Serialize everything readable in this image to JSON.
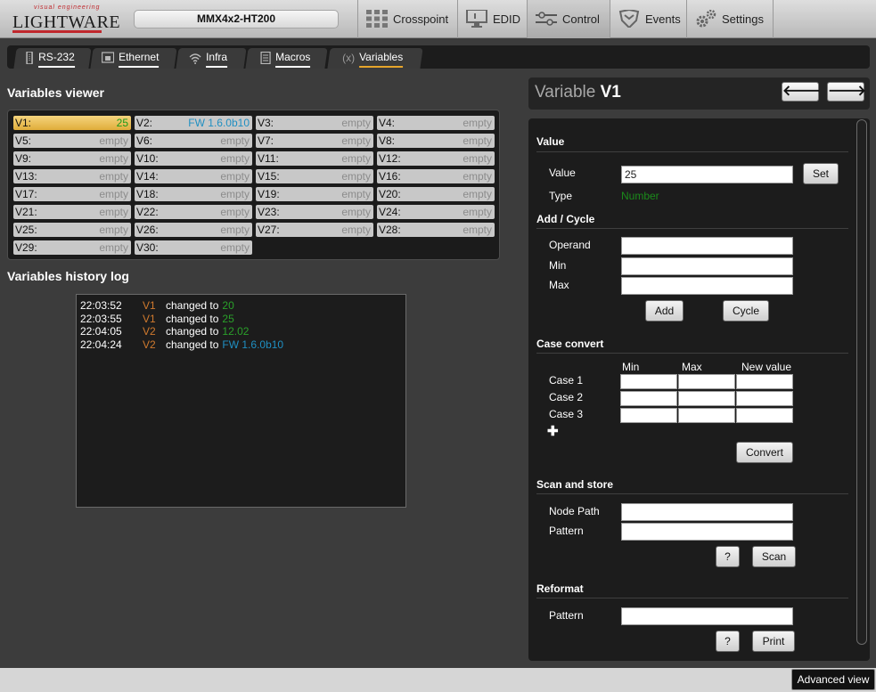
{
  "app": {
    "logo_tagline": "visual engineering",
    "logo_name": "LIGHTWARE",
    "device_name": "MMX4x2-HT200"
  },
  "nav": {
    "tabs": [
      {
        "label": "Crosspoint",
        "icon": "grid-icon"
      },
      {
        "label": "EDID",
        "icon": "monitor-icon"
      },
      {
        "label": "Control",
        "icon": "sliders-icon",
        "active": true
      },
      {
        "label": "Events",
        "icon": "shield-icon"
      },
      {
        "label": "Settings",
        "icon": "gears-icon"
      }
    ]
  },
  "subtabs": [
    {
      "label": "RS-232",
      "icon": "serial-icon"
    },
    {
      "label": "Ethernet",
      "icon": "ethernet-icon"
    },
    {
      "label": "Infra",
      "icon": "wifi-icon"
    },
    {
      "label": "Macros",
      "icon": "document-icon"
    },
    {
      "label": "Variables",
      "icon_text": "(x)",
      "active": true
    }
  ],
  "viewer": {
    "heading": "Variables viewer",
    "variables": [
      {
        "name": "V1:",
        "value": "25"
      },
      {
        "name": "V2:",
        "value": "FW 1.6.0b10"
      },
      {
        "name": "V3:",
        "value": "empty"
      },
      {
        "name": "V4:",
        "value": "empty"
      },
      {
        "name": "V5:",
        "value": "empty"
      },
      {
        "name": "V6:",
        "value": "empty"
      },
      {
        "name": "V7:",
        "value": "empty"
      },
      {
        "name": "V8:",
        "value": "empty"
      },
      {
        "name": "V9:",
        "value": "empty"
      },
      {
        "name": "V10:",
        "value": "empty"
      },
      {
        "name": "V11:",
        "value": "empty"
      },
      {
        "name": "V12:",
        "value": "empty"
      },
      {
        "name": "V13:",
        "value": "empty"
      },
      {
        "name": "V14:",
        "value": "empty"
      },
      {
        "name": "V15:",
        "value": "empty"
      },
      {
        "name": "V16:",
        "value": "empty"
      },
      {
        "name": "V17:",
        "value": "empty"
      },
      {
        "name": "V18:",
        "value": "empty"
      },
      {
        "name": "V19:",
        "value": "empty"
      },
      {
        "name": "V20:",
        "value": "empty"
      },
      {
        "name": "V21:",
        "value": "empty"
      },
      {
        "name": "V22:",
        "value": "empty"
      },
      {
        "name": "V23:",
        "value": "empty"
      },
      {
        "name": "V24:",
        "value": "empty"
      },
      {
        "name": "V25:",
        "value": "empty"
      },
      {
        "name": "V26:",
        "value": "empty"
      },
      {
        "name": "V27:",
        "value": "empty"
      },
      {
        "name": "V28:",
        "value": "empty"
      },
      {
        "name": "V29:",
        "value": "empty"
      },
      {
        "name": "V30:",
        "value": "empty"
      }
    ]
  },
  "history": {
    "heading": "Variables history log",
    "entries": [
      {
        "time": "22:03:52",
        "var": "V1",
        "text": "changed to",
        "value": "20",
        "value_color": "green"
      },
      {
        "time": "22:03:55",
        "var": "V1",
        "text": "changed to",
        "value": "25",
        "value_color": "green"
      },
      {
        "time": "22:04:05",
        "var": "V2",
        "text": "changed to",
        "value": "12.02",
        "value_color": "green"
      },
      {
        "time": "22:04:24",
        "var": "V2",
        "text": "changed to",
        "value": "FW 1.6.0b10",
        "value_color": "blue"
      }
    ]
  },
  "detail": {
    "title_prefix": "Variable",
    "title_var": "V1",
    "prev_icon": "arrow-left-icon",
    "next_icon": "arrow-right-icon",
    "prev_glyph": "🡐",
    "next_glyph": "🡒",
    "value_section": {
      "heading": "Value",
      "value_label": "Value",
      "value": "25",
      "set_label": "Set",
      "type_label": "Type",
      "type_value": "Number"
    },
    "add_cycle": {
      "heading": "Add / Cycle",
      "operand_label": "Operand",
      "min_label": "Min",
      "max_label": "Max",
      "add_label": "Add",
      "cycle_label": "Cycle"
    },
    "case_convert": {
      "heading": "Case convert",
      "col_min": "Min",
      "col_max": "Max",
      "col_new": "New value",
      "rows": [
        "Case 1",
        "Case 2",
        "Case 3"
      ],
      "add_glyph": "✚",
      "convert_label": "Convert"
    },
    "scan_store": {
      "heading": "Scan and store",
      "node_label": "Node Path",
      "pattern_label": "Pattern",
      "help_label": "?",
      "scan_label": "Scan"
    },
    "reformat": {
      "heading": "Reformat",
      "pattern_label": "Pattern",
      "help_label": "?",
      "print_label": "Print"
    }
  },
  "footer": {
    "advanced_label": "Advanced view"
  },
  "colors": {
    "accent": "#e6a52b",
    "brand_red": "#c0282d",
    "value_green": "#2aa02a",
    "value_blue": "#1f8fc2",
    "var_orange": "#d07a2e"
  }
}
